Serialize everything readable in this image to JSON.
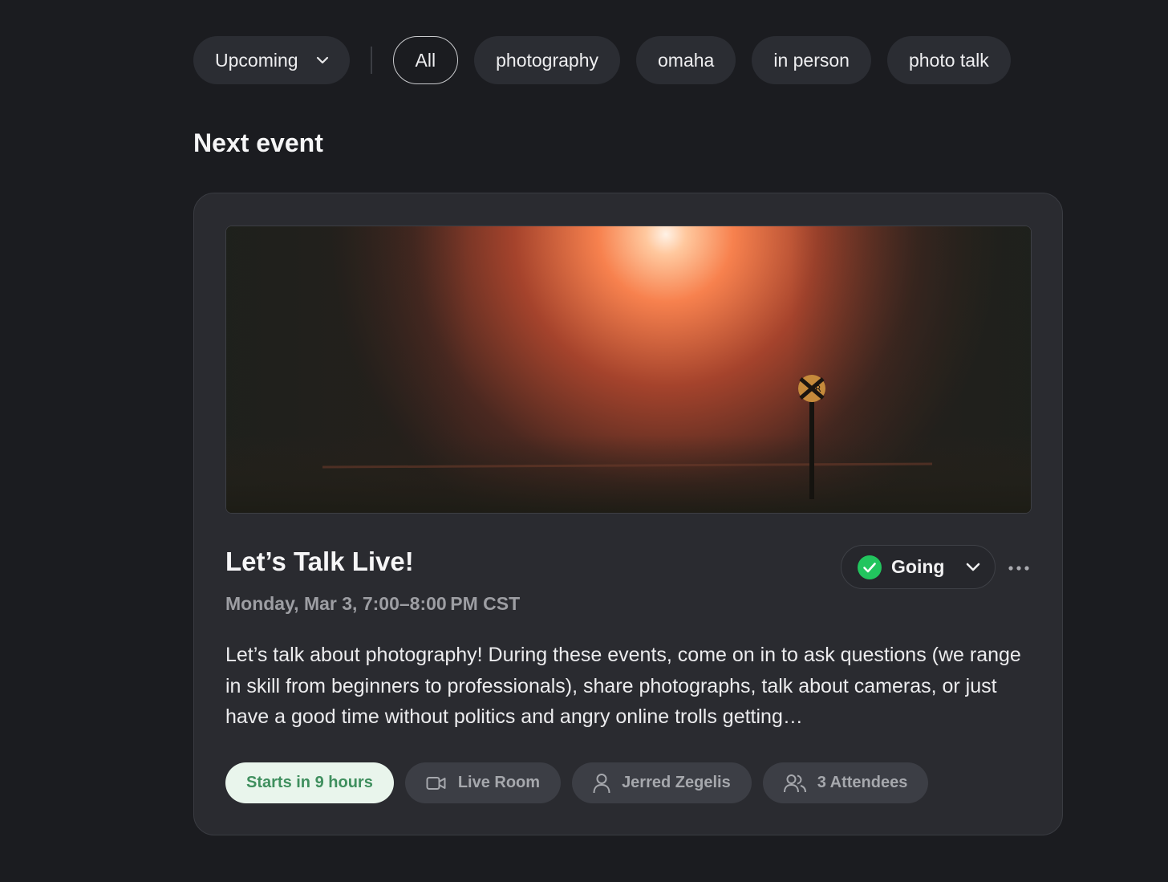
{
  "filters": {
    "time_filter": {
      "label": "Upcoming",
      "icon": "chevron-down-icon"
    },
    "tags": [
      "All",
      "photography",
      "omaha",
      "in person",
      "photo talk"
    ],
    "active_tag": "All"
  },
  "section_title": "Next event",
  "event": {
    "title": "Let’s Talk Live!",
    "datetime": "Monday, Mar 3, 7:00–8:00 PM CST",
    "rsvp": {
      "label": "Going",
      "status_color": "#22c55e"
    },
    "description": "Let’s talk about photography!  During these events, come on in to ask questions (we range in skill from beginners to professionals), share photographs, talk about cameras, or just have a good time without politics and angry online trolls getting…",
    "chips": {
      "starts": "Starts in 9 hours",
      "location": "Live Room",
      "host": "Jerred Zegelis",
      "attendees": "3 Attendees"
    },
    "image": {
      "subject": "foggy night railroad crossing sign under orange streetlight"
    }
  },
  "colors": {
    "background": "#1b1c20",
    "card": "#2a2b30",
    "pill": "#2b2d33",
    "success": "#22c55e",
    "starts_chip_bg": "#e9f5ec",
    "starts_chip_text": "#3f8f5e"
  }
}
